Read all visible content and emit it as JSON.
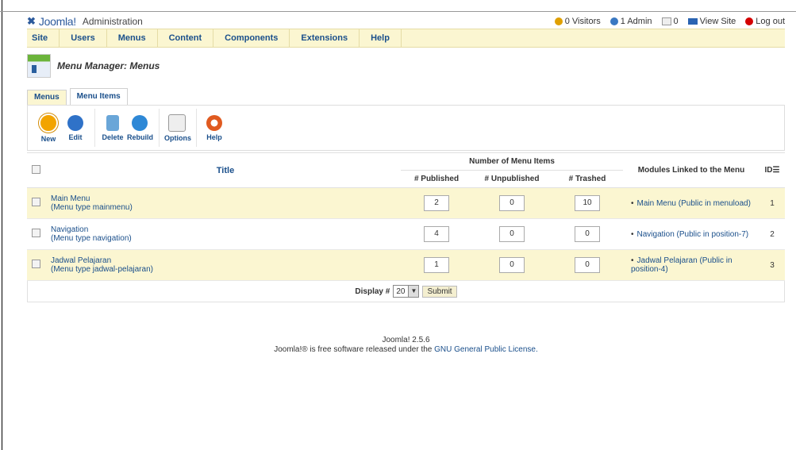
{
  "header": {
    "brand": "Joomla!",
    "admin_label": "Administration",
    "status": {
      "visitors": "0 Visitors",
      "admins": "1 Admin",
      "messages": "0",
      "view_site": "View Site",
      "logout": "Log out"
    }
  },
  "menubar": [
    "Site",
    "Users",
    "Menus",
    "Content",
    "Components",
    "Extensions",
    "Help"
  ],
  "page_title": "Menu Manager: Menus",
  "tabs": [
    "Menus",
    "Menu Items"
  ],
  "toolbar": {
    "new": "New",
    "edit": "Edit",
    "delete": "Delete",
    "rebuild": "Rebuild",
    "options": "Options",
    "help": "Help"
  },
  "table": {
    "headers": {
      "title": "Title",
      "number_of_items": "Number of Menu Items",
      "published": "# Published",
      "unpublished": "# Unpublished",
      "trashed": "# Trashed",
      "modules": "Modules Linked to the Menu",
      "id": "ID"
    },
    "rows": [
      {
        "name": "Main Menu",
        "type": "(Menu type mainmenu)",
        "published": "2",
        "unpublished": "0",
        "trashed": "10",
        "module": "Main Menu (Public in menuload)",
        "id": "1"
      },
      {
        "name": "Navigation",
        "type": "(Menu type navigation)",
        "published": "4",
        "unpublished": "0",
        "trashed": "0",
        "module": "Navigation (Public in position-7)",
        "id": "2"
      },
      {
        "name": "Jadwal Pelajaran",
        "type": "(Menu type jadwal-pelajaran)",
        "published": "1",
        "unpublished": "0",
        "trashed": "0",
        "module": "Jadwal Pelajaran (Public in position-4)",
        "id": "3"
      }
    ]
  },
  "pager": {
    "label": "Display #",
    "value": "20",
    "submit": "Submit"
  },
  "footer": {
    "version": "Joomla! 2.5.6",
    "license_prefix": "Joomla!® is free software released under the",
    "license_link": "GNU General Public License."
  }
}
